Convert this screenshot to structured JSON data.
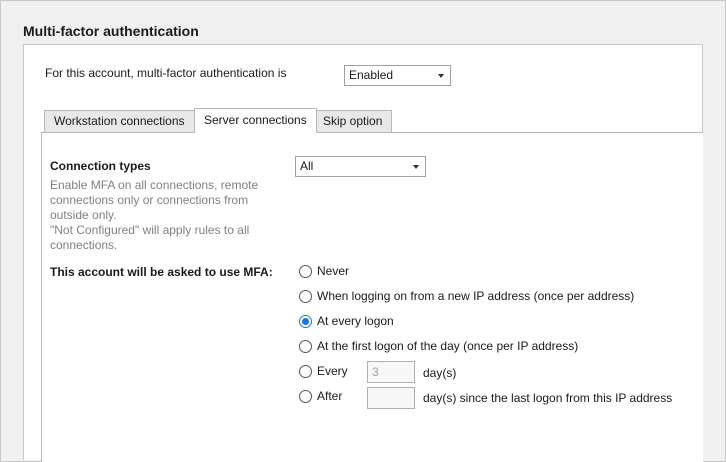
{
  "section": {
    "title": "Multi-factor authentication"
  },
  "account_status": {
    "label": "For this account, multi-factor authentication is",
    "value": "Enabled"
  },
  "tabs": [
    {
      "label": "Workstation connections",
      "active": false
    },
    {
      "label": "Server connections",
      "active": true
    },
    {
      "label": "Skip option",
      "active": false
    }
  ],
  "connection_types": {
    "title": "Connection types",
    "description_lines": [
      "Enable MFA on all connections, remote",
      "connections only or connections from",
      "outside only.",
      "\"Not Configured\" will apply rules to all",
      "connections."
    ],
    "value": "All"
  },
  "mfa_frequency": {
    "label": "This account will be asked to use MFA:",
    "options": [
      {
        "label": "Never",
        "checked": false
      },
      {
        "label": "When logging on from a new IP address (once per address)",
        "checked": false
      },
      {
        "label": "At every logon",
        "checked": true
      },
      {
        "label": "At the first logon of the day (once per IP address)",
        "checked": false
      },
      {
        "label": "Every",
        "checked": false,
        "input_value": "3",
        "suffix": "day(s)"
      },
      {
        "label": "After",
        "checked": false,
        "input_value": "",
        "suffix": "day(s) since the last logon from this IP address"
      }
    ]
  },
  "colors": {
    "accent": "#1a73e8",
    "border": "#c8c8c8",
    "muted_text": "#808080"
  }
}
